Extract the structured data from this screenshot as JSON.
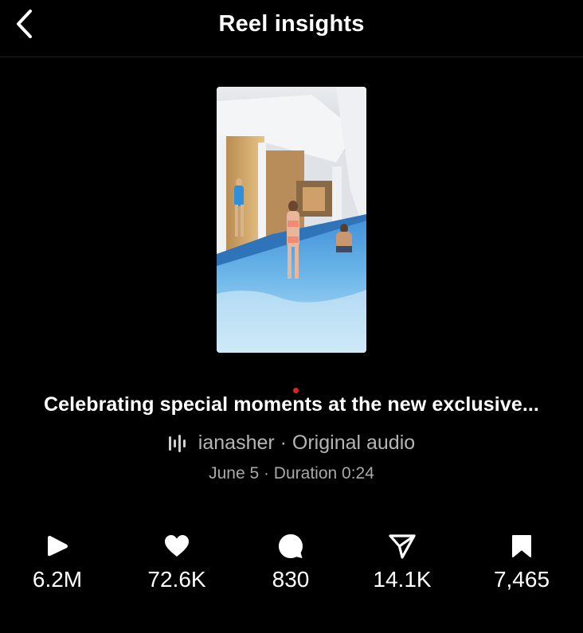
{
  "header": {
    "title": "Reel insights",
    "back_icon": "chevron-left-icon"
  },
  "reel": {
    "thumbnail_alt": "Reel thumbnail",
    "caption": "Celebrating special moments at the new exclusive...",
    "audio_icon": "audio-waveform-icon",
    "audio_text": "ianasher · Original audio",
    "meta_text": "June 5 · Duration 0:24"
  },
  "stats": [
    {
      "icon": "play-icon",
      "value": "6.2M"
    },
    {
      "icon": "heart-icon",
      "value": "72.6K"
    },
    {
      "icon": "comment-icon",
      "value": "830"
    },
    {
      "icon": "share-icon",
      "value": "14.1K"
    },
    {
      "icon": "bookmark-icon",
      "value": "7,465"
    }
  ],
  "colors": {
    "background": "#000000",
    "text_primary": "#ffffff",
    "text_secondary": "#a8a8a8",
    "indicator": "#e0241b"
  }
}
